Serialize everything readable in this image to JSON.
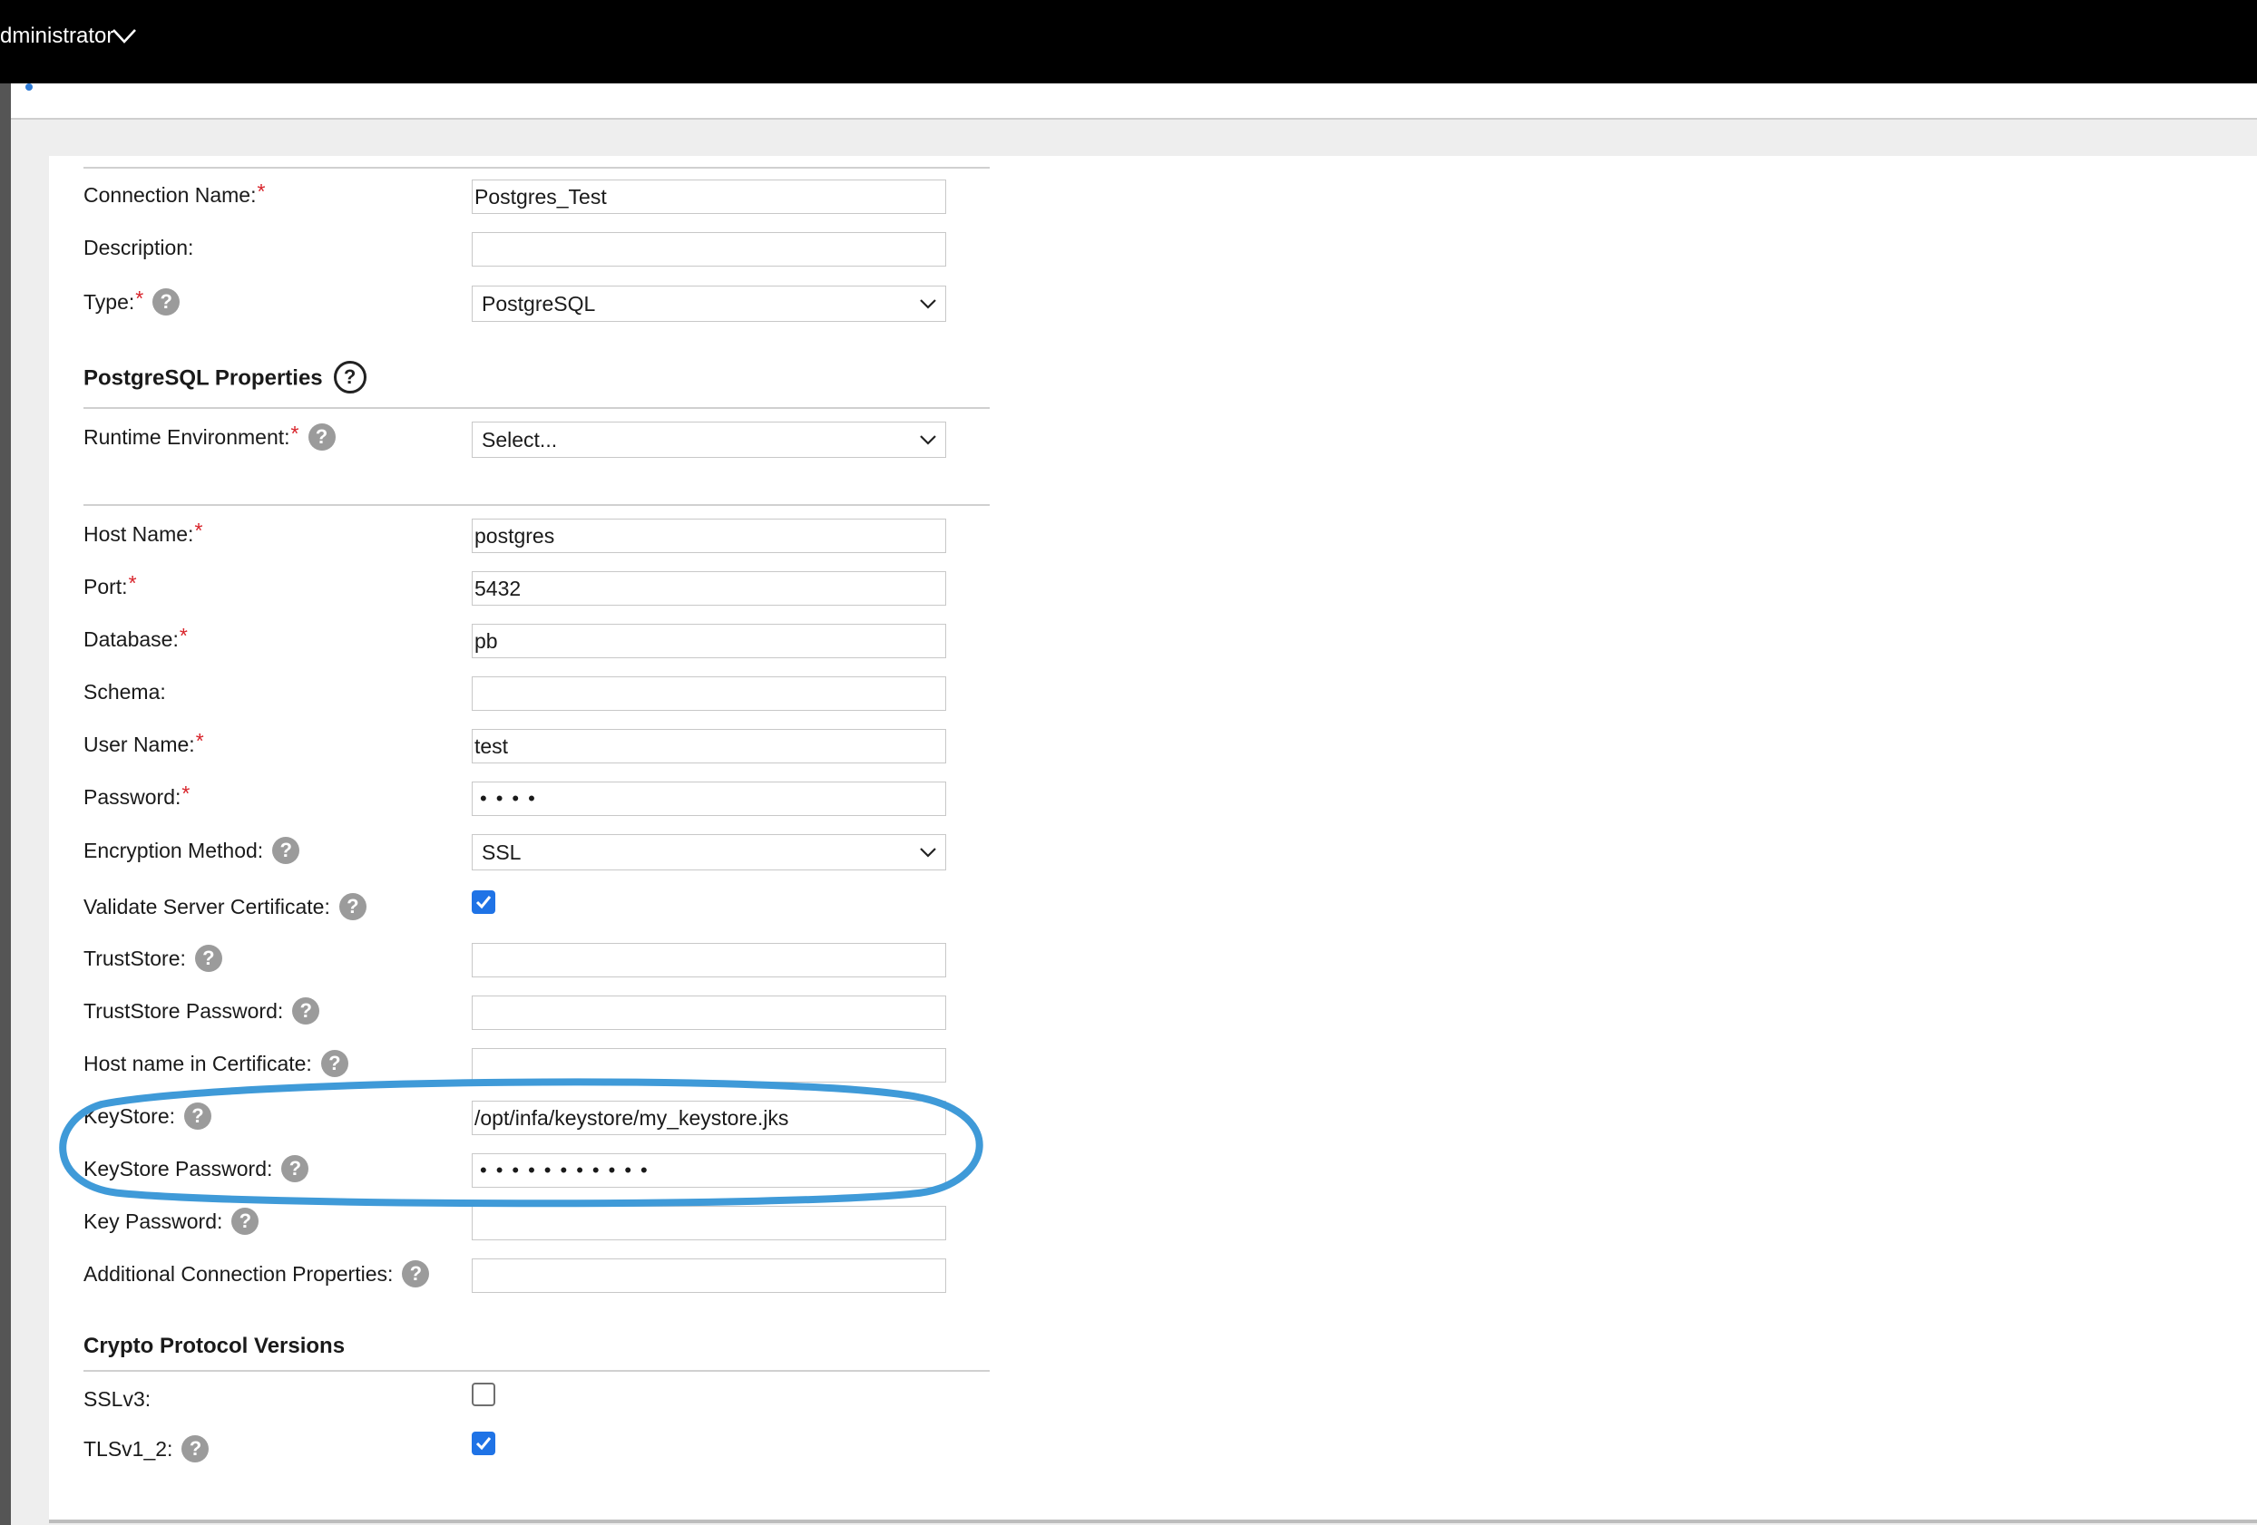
{
  "header": {
    "user": "dministrator"
  },
  "form": {
    "connection_name": {
      "label": "Connection Name:",
      "value": "Postgres_Test"
    },
    "description": {
      "label": "Description:",
      "value": ""
    },
    "type": {
      "label": "Type:",
      "value": "PostgreSQL"
    },
    "props_title": "PostgreSQL Properties",
    "runtime_env": {
      "label": "Runtime Environment:",
      "value": "Select..."
    },
    "host_name": {
      "label": "Host Name:",
      "value": "postgres"
    },
    "port": {
      "label": "Port:",
      "value": "5432"
    },
    "database": {
      "label": "Database:",
      "value": "pb"
    },
    "schema": {
      "label": "Schema:",
      "value": ""
    },
    "user_name": {
      "label": "User Name:",
      "value": "test"
    },
    "password": {
      "label": "Password:",
      "value": "••••"
    },
    "encryption_method": {
      "label": "Encryption Method:",
      "value": "SSL"
    },
    "validate_cert": {
      "label": "Validate Server Certificate:",
      "checked": true
    },
    "truststore": {
      "label": "TrustStore:",
      "value": ""
    },
    "truststore_password": {
      "label": "TrustStore Password:",
      "value": ""
    },
    "host_in_cert": {
      "label": "Host name in Certificate:",
      "value": ""
    },
    "keystore": {
      "label": "KeyStore:",
      "value": "/opt/infa/keystore/my_keystore.jks"
    },
    "keystore_password": {
      "label": "KeyStore Password:",
      "value": "•••••••••••"
    },
    "key_password": {
      "label": "Key Password:",
      "value": ""
    },
    "additional_props": {
      "label": "Additional Connection Properties:",
      "value": ""
    }
  },
  "crypto": {
    "title": "Crypto Protocol Versions",
    "sslv3": {
      "label": "SSLv3:",
      "checked": false
    },
    "tlsv1_2": {
      "label": "TLSv1_2:",
      "checked": true
    }
  },
  "help_glyph": "?",
  "required_mark": "*",
  "colors": {
    "accent": "#1f73e6",
    "annotation": "#3f9ad8",
    "required": "#d8232a",
    "topbar": "#000000"
  }
}
